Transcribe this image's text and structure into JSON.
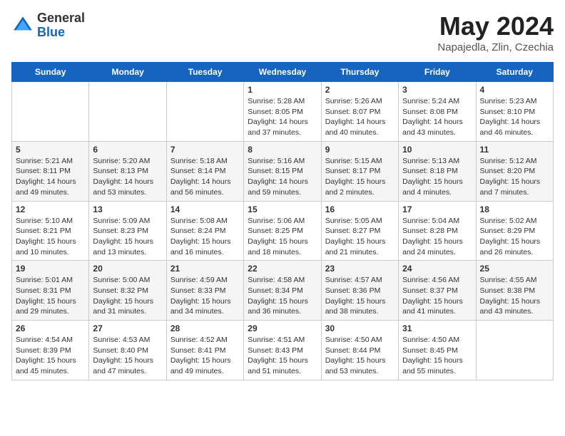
{
  "header": {
    "logo_general": "General",
    "logo_blue": "Blue",
    "month_title": "May 2024",
    "location": "Napajedla, Zlin, Czechia"
  },
  "days_of_week": [
    "Sunday",
    "Monday",
    "Tuesday",
    "Wednesday",
    "Thursday",
    "Friday",
    "Saturday"
  ],
  "weeks": [
    [
      {
        "day": "",
        "info": ""
      },
      {
        "day": "",
        "info": ""
      },
      {
        "day": "",
        "info": ""
      },
      {
        "day": "1",
        "info": "Sunrise: 5:28 AM\nSunset: 8:05 PM\nDaylight: 14 hours and 37 minutes."
      },
      {
        "day": "2",
        "info": "Sunrise: 5:26 AM\nSunset: 8:07 PM\nDaylight: 14 hours and 40 minutes."
      },
      {
        "day": "3",
        "info": "Sunrise: 5:24 AM\nSunset: 8:08 PM\nDaylight: 14 hours and 43 minutes."
      },
      {
        "day": "4",
        "info": "Sunrise: 5:23 AM\nSunset: 8:10 PM\nDaylight: 14 hours and 46 minutes."
      }
    ],
    [
      {
        "day": "5",
        "info": "Sunrise: 5:21 AM\nSunset: 8:11 PM\nDaylight: 14 hours and 49 minutes."
      },
      {
        "day": "6",
        "info": "Sunrise: 5:20 AM\nSunset: 8:13 PM\nDaylight: 14 hours and 53 minutes."
      },
      {
        "day": "7",
        "info": "Sunrise: 5:18 AM\nSunset: 8:14 PM\nDaylight: 14 hours and 56 minutes."
      },
      {
        "day": "8",
        "info": "Sunrise: 5:16 AM\nSunset: 8:15 PM\nDaylight: 14 hours and 59 minutes."
      },
      {
        "day": "9",
        "info": "Sunrise: 5:15 AM\nSunset: 8:17 PM\nDaylight: 15 hours and 2 minutes."
      },
      {
        "day": "10",
        "info": "Sunrise: 5:13 AM\nSunset: 8:18 PM\nDaylight: 15 hours and 4 minutes."
      },
      {
        "day": "11",
        "info": "Sunrise: 5:12 AM\nSunset: 8:20 PM\nDaylight: 15 hours and 7 minutes."
      }
    ],
    [
      {
        "day": "12",
        "info": "Sunrise: 5:10 AM\nSunset: 8:21 PM\nDaylight: 15 hours and 10 minutes."
      },
      {
        "day": "13",
        "info": "Sunrise: 5:09 AM\nSunset: 8:23 PM\nDaylight: 15 hours and 13 minutes."
      },
      {
        "day": "14",
        "info": "Sunrise: 5:08 AM\nSunset: 8:24 PM\nDaylight: 15 hours and 16 minutes."
      },
      {
        "day": "15",
        "info": "Sunrise: 5:06 AM\nSunset: 8:25 PM\nDaylight: 15 hours and 18 minutes."
      },
      {
        "day": "16",
        "info": "Sunrise: 5:05 AM\nSunset: 8:27 PM\nDaylight: 15 hours and 21 minutes."
      },
      {
        "day": "17",
        "info": "Sunrise: 5:04 AM\nSunset: 8:28 PM\nDaylight: 15 hours and 24 minutes."
      },
      {
        "day": "18",
        "info": "Sunrise: 5:02 AM\nSunset: 8:29 PM\nDaylight: 15 hours and 26 minutes."
      }
    ],
    [
      {
        "day": "19",
        "info": "Sunrise: 5:01 AM\nSunset: 8:31 PM\nDaylight: 15 hours and 29 minutes."
      },
      {
        "day": "20",
        "info": "Sunrise: 5:00 AM\nSunset: 8:32 PM\nDaylight: 15 hours and 31 minutes."
      },
      {
        "day": "21",
        "info": "Sunrise: 4:59 AM\nSunset: 8:33 PM\nDaylight: 15 hours and 34 minutes."
      },
      {
        "day": "22",
        "info": "Sunrise: 4:58 AM\nSunset: 8:34 PM\nDaylight: 15 hours and 36 minutes."
      },
      {
        "day": "23",
        "info": "Sunrise: 4:57 AM\nSunset: 8:36 PM\nDaylight: 15 hours and 38 minutes."
      },
      {
        "day": "24",
        "info": "Sunrise: 4:56 AM\nSunset: 8:37 PM\nDaylight: 15 hours and 41 minutes."
      },
      {
        "day": "25",
        "info": "Sunrise: 4:55 AM\nSunset: 8:38 PM\nDaylight: 15 hours and 43 minutes."
      }
    ],
    [
      {
        "day": "26",
        "info": "Sunrise: 4:54 AM\nSunset: 8:39 PM\nDaylight: 15 hours and 45 minutes."
      },
      {
        "day": "27",
        "info": "Sunrise: 4:53 AM\nSunset: 8:40 PM\nDaylight: 15 hours and 47 minutes."
      },
      {
        "day": "28",
        "info": "Sunrise: 4:52 AM\nSunset: 8:41 PM\nDaylight: 15 hours and 49 minutes."
      },
      {
        "day": "29",
        "info": "Sunrise: 4:51 AM\nSunset: 8:43 PM\nDaylight: 15 hours and 51 minutes."
      },
      {
        "day": "30",
        "info": "Sunrise: 4:50 AM\nSunset: 8:44 PM\nDaylight: 15 hours and 53 minutes."
      },
      {
        "day": "31",
        "info": "Sunrise: 4:50 AM\nSunset: 8:45 PM\nDaylight: 15 hours and 55 minutes."
      },
      {
        "day": "",
        "info": ""
      }
    ]
  ]
}
